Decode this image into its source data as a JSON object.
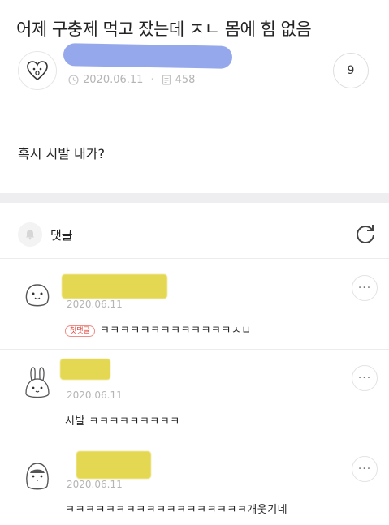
{
  "post": {
    "title": "어제 구충제 먹고 잤는데 ㅈㄴ 몸에 힘 없음",
    "date": "2020.06.11",
    "views": "458",
    "comment_count": "9",
    "body": "혹시 시발 내가?"
  },
  "comments_section": {
    "label": "댓글"
  },
  "comments": [
    {
      "date": "2020.06.11",
      "badge": "첫댓글",
      "text": "ㅋㅋㅋㅋㅋㅋㅋㅋㅋㅋㅋㅋㅋㅅㅂ",
      "avatar": "blob-face-icon"
    },
    {
      "date": "2020.06.11",
      "text": "시발 ㅋㅋㅋㅋㅋㅋㅋㅋㅋ",
      "avatar": "rabbit-icon"
    },
    {
      "date": "2020.06.11",
      "text": "ㅋㅋㅋㅋㅋㅋㅋㅋㅋㅋㅋㅋㅋㅋㅋㅋㅋㅋ개웃기네",
      "avatar": "penguin-icon"
    }
  ],
  "colors": {
    "redact_author": "#8fa3ea",
    "redact_comment": "#e3d64a",
    "first_badge": "#e0453a"
  }
}
